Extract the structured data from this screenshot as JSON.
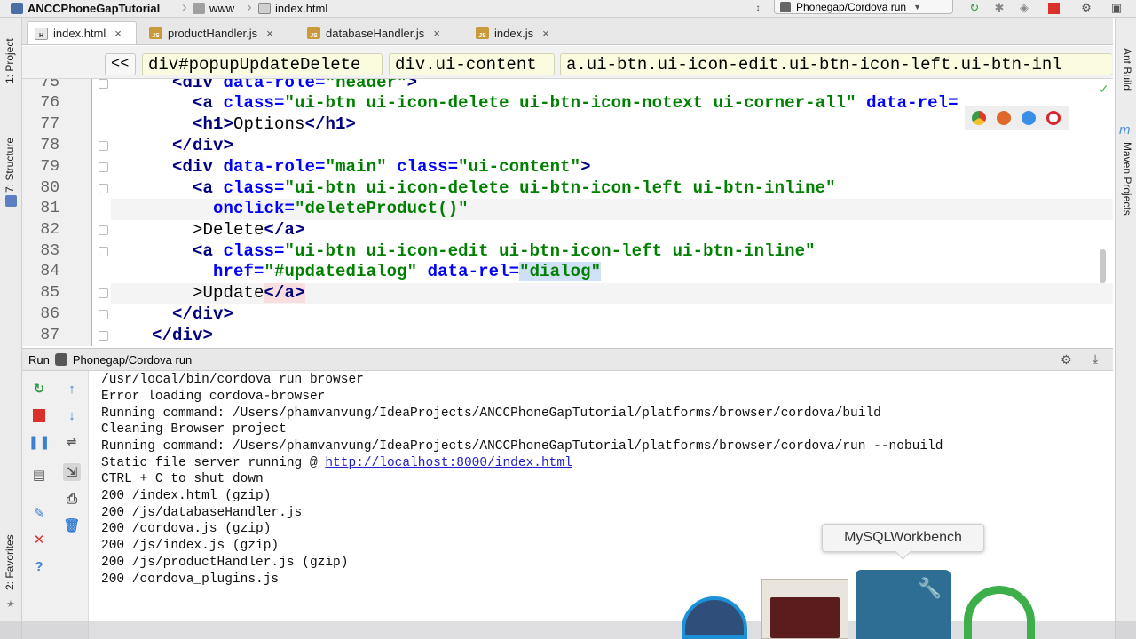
{
  "navbar": {
    "crumbs": [
      "ANCCPhoneGapTutorial",
      "www",
      "index.html"
    ],
    "run_config": "Phonegap/Cordova run"
  },
  "tabs": [
    {
      "label": "index.html",
      "icon": "html-file-icon",
      "active": true
    },
    {
      "label": "productHandler.js",
      "icon": "js-file-icon",
      "active": false
    },
    {
      "label": "databaseHandler.js",
      "icon": "js-file-icon",
      "active": false
    },
    {
      "label": "index.js",
      "icon": "js-file-icon",
      "active": false
    }
  ],
  "tab_close_glyph": "×",
  "left_strip": {
    "project": "1: Project",
    "structure": "7: Structure",
    "favorites": "2: Favorites"
  },
  "right_strip": {
    "ant_build": "Ant Build",
    "maven": "Maven Projects"
  },
  "tagbar": {
    "back": "<<",
    "items": [
      "div#popupUpdateDelete",
      "div.ui-content",
      "a.ui-btn.ui-icon-edit.ui-btn-icon-left.ui-btn-inl"
    ]
  },
  "editor": {
    "line_numbers": [
      "75",
      "76",
      "77",
      "78",
      "79",
      "80",
      "81",
      "82",
      "83",
      "84",
      "85",
      "86",
      "87"
    ],
    "lines": {
      "l75": {
        "indent": "      ",
        "t1": "<div ",
        "a1": "data-role=",
        "v1": "\"header\"",
        "t2": ">"
      },
      "l76": {
        "indent": "        ",
        "t1": "<a ",
        "a1": "class=",
        "v1": "\"ui-btn ui-icon-delete ui-btn-icon-notext ui-corner-all\"",
        "a2": " data-rel="
      },
      "l77": {
        "indent": "        ",
        "t1": "<h1>",
        "x1": "Options",
        "t2": "</h1>"
      },
      "l78": {
        "indent": "      ",
        "t1": "</div>"
      },
      "l79": {
        "indent": "      ",
        "t1": "<div ",
        "a1": "data-role=",
        "v1": "\"main\"",
        "a2": " class=",
        "v2": "\"ui-content\"",
        "t2": ">"
      },
      "l80": {
        "indent": "        ",
        "t1": "<a ",
        "a1": "class=",
        "v1": "\"ui-btn ui-icon-delete ui-btn-icon-left ui-btn-inline\""
      },
      "l81": {
        "indent": "          ",
        "a1": "onclick=",
        "v1": "\"deleteProduct()\""
      },
      "l82": {
        "indent": "        ",
        "x1": ">Delete",
        "t1": "</a>"
      },
      "l83": {
        "indent": "        ",
        "t1": "<a ",
        "a1": "class=",
        "v1": "\"ui-btn ui-icon-edit ui-btn-icon-left ui-btn-inline\""
      },
      "l84": {
        "indent": "          ",
        "a1": "href=",
        "v1": "\"#updatedialog\"",
        "a2": " data-rel=",
        "v2": "\"dialog\""
      },
      "l85": {
        "indent": "        ",
        "x1": ">Update",
        "t1": "</a>"
      },
      "l86": {
        "indent": "      ",
        "t1": "</div>"
      },
      "l87": {
        "indent": "    ",
        "t1": "</div>"
      }
    }
  },
  "run_panel": {
    "label": "Run",
    "config": "Phonegap/Cordova run",
    "console": [
      "/usr/local/bin/cordova run browser",
      "Error loading cordova-browser",
      "Running command: /Users/phamvanvung/IdeaProjects/ANCCPhoneGapTutorial/platforms/browser/cordova/build",
      "Cleaning Browser project",
      "Running command: /Users/phamvanvung/IdeaProjects/ANCCPhoneGapTutorial/platforms/browser/cordova/run --nobuild",
      "Static file server running @ ",
      "CTRL + C to shut down",
      "200 /index.html (gzip)",
      "200 /js/databaseHandler.js",
      "200 /cordova.js (gzip)",
      "200 /js/index.js (gzip)",
      "200 /js/productHandler.js (gzip)",
      "200 /cordova_plugins.js"
    ],
    "server_url": "http://localhost:8000/index.html"
  },
  "dock": {
    "tooltip": "MySQLWorkbench"
  },
  "colors": {
    "tag": "#000080",
    "attr": "#0000ff",
    "value": "#008000",
    "link": "#2222cc"
  }
}
